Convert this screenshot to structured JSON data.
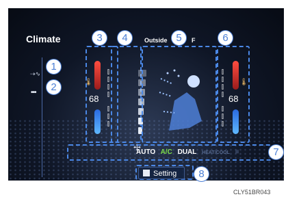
{
  "screen": {
    "title": "Climate",
    "outside_label": "Outside",
    "outside_unit": "F"
  },
  "left_temp": {
    "value": "68"
  },
  "right_temp": {
    "value": "68"
  },
  "fan": {
    "level_fraction": 0.55
  },
  "bottom_bar": {
    "auto": "AUTO",
    "ac": "A/C",
    "dual": "DUAL",
    "heatcool": "HEAT/COOL",
    "extra": "≡"
  },
  "setting_button": {
    "label": "Setting"
  },
  "callouts": [
    "1",
    "2",
    "3",
    "4",
    "5",
    "6",
    "7",
    "8"
  ],
  "image_code": "CLY51BR043",
  "colors": {
    "callout": "#4b7fd6",
    "ac_active": "#7fe04a",
    "hot": "#ff4d40",
    "cold": "#2a6ae0"
  }
}
